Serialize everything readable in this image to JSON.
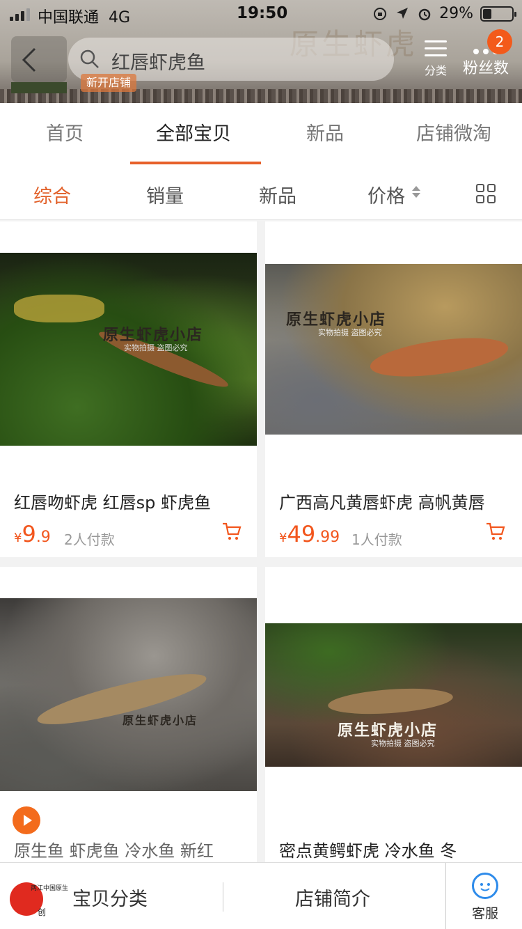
{
  "status": {
    "carrier": "中国联通",
    "network": "4G",
    "time": "19:50",
    "battery_pct": "29%",
    "battery_level": 0.29
  },
  "header": {
    "search_text": "红唇虾虎鱼",
    "new_shop_tag": "新开店铺",
    "category_label": "分类",
    "fans_label": "粉丝数",
    "badge_count": "2",
    "banner_deco": "原生虾虎"
  },
  "tabs": [
    {
      "label": "首页"
    },
    {
      "label": "全部宝贝"
    },
    {
      "label": "新品"
    },
    {
      "label": "店铺微淘"
    }
  ],
  "sort": [
    {
      "label": "综合"
    },
    {
      "label": "销量"
    },
    {
      "label": "新品"
    },
    {
      "label": "价格"
    }
  ],
  "products": [
    {
      "title": "红唇吻虾虎 红唇sp 虾虎鱼",
      "yen": "¥",
      "price_int": "9",
      "price_dec": ".9",
      "paid": "2人付款",
      "watermark": "原生虾虎小店",
      "watermark_sub": "实物拍摄  盗图必究"
    },
    {
      "title": "广西高凡黄唇虾虎 高帆黄唇",
      "yen": "¥",
      "price_int": "49",
      "price_dec": ".99",
      "paid": "1人付款",
      "watermark": "原生虾虎小店",
      "watermark_sub": "实物拍摄  盗图必究"
    },
    {
      "title": "原生鱼 虾虎鱼 冷水鱼 新红",
      "watermark": "原生虾虎小店"
    },
    {
      "title": "密点黄鳄虾虎  冷水鱼  冬",
      "watermark": "原生虾虎小店",
      "watermark_sub": "实物拍摄  盗图必究"
    }
  ],
  "bottom": {
    "categories": "宝贝分类",
    "intro": "店铺简介",
    "service": "客服",
    "logo_text": "两江中国原生",
    "logo_sub": "创"
  },
  "colors": {
    "accent": "#e7602a",
    "price": "#f2561d",
    "badge": "#f35a1b"
  }
}
